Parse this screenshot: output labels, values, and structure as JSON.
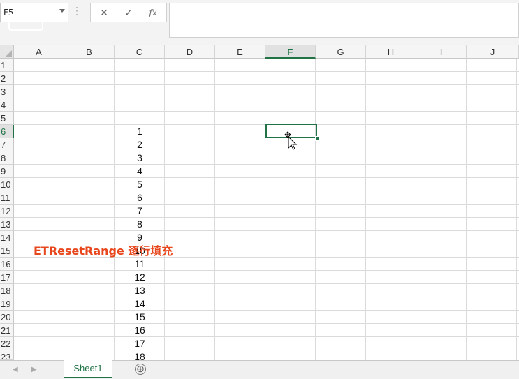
{
  "formula_bar": {
    "name_box": "F5",
    "cancel_icon": "✕",
    "enter_icon": "✓",
    "function_icon": "fx",
    "formula_value": ""
  },
  "columns": [
    "A",
    "B",
    "C",
    "D",
    "E",
    "F",
    "G",
    "H",
    "I",
    "J"
  ],
  "rows": [
    "1",
    "2",
    "3",
    "4",
    "5",
    "6",
    "7",
    "8",
    "9",
    "10",
    "11",
    "12",
    "13",
    "14",
    "15",
    "16",
    "17",
    "18",
    "19",
    "20",
    "21",
    "22",
    "23"
  ],
  "selected_cell": {
    "column": "F",
    "row": "6"
  },
  "column_c_values": [
    "1",
    "2",
    "3",
    "4",
    "5",
    "6",
    "7",
    "8",
    "9",
    "10",
    "11",
    "12",
    "13",
    "14",
    "15",
    "16",
    "17",
    "18"
  ],
  "overlay_caption": "ETResetRange 逐行填充",
  "sheet_tabs": [
    "Sheet1"
  ],
  "add_sheet_icon": "⊕",
  "colors": {
    "accent": "#217346",
    "caption": "#e8471d"
  }
}
